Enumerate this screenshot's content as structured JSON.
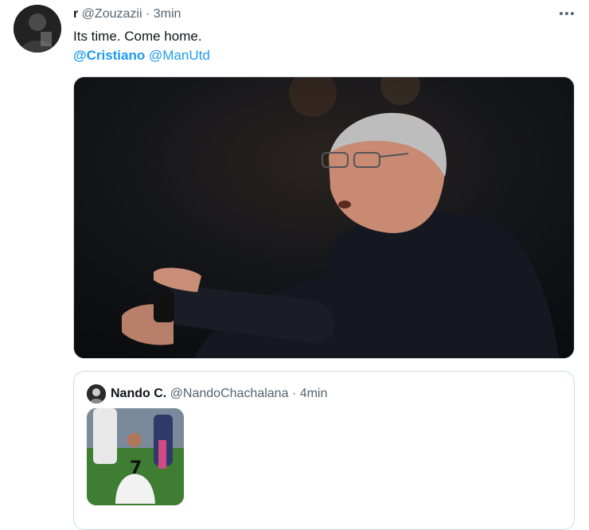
{
  "tweet": {
    "avatar_icon": "user-avatar-icon",
    "name": "r",
    "handle": "@Zouzazii",
    "separator": "·",
    "time": "3min",
    "more_icon": "more-options-icon",
    "text": "Its time. Come home.",
    "mention1": "@Cristiano",
    "mention2": "@ManUtd",
    "media_icon": "photo-image"
  },
  "quoted": {
    "avatar_icon": "user-avatar-icon",
    "name": "Nando C.",
    "handle": "@NandoChachalana",
    "separator": "·",
    "time": "4min",
    "media_icon": "photo-thumbnail-image"
  },
  "colors": {
    "link": "#1d9bf0",
    "secondary_text": "#536471",
    "border": "#cfd9de"
  }
}
